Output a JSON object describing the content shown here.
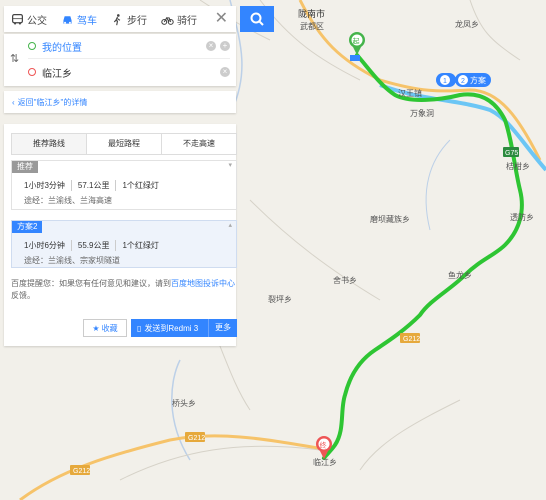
{
  "modes": [
    {
      "label": "公交",
      "icon": "bus-icon"
    },
    {
      "label": "驾车",
      "icon": "car-icon"
    },
    {
      "label": "步行",
      "icon": "walk-icon"
    },
    {
      "label": "骑行",
      "icon": "bike-icon"
    }
  ],
  "active_mode": "驾车",
  "close_label": "✕",
  "route": {
    "start": "我的位置",
    "end": "临江乡"
  },
  "back_link": "返回\"临江乡\"的详情",
  "preferences": [
    "推荐路线",
    "最短路程",
    "不走高速"
  ],
  "plans": [
    {
      "tag": "推荐",
      "time": "1小时3分钟",
      "distance": "57.1公里",
      "lights": "1个红绿灯",
      "via": "途经：兰渝线、兰海高速"
    },
    {
      "tag": "方案2",
      "time": "1小时6分钟",
      "distance": "55.9公里",
      "lights": "1个红绿灯",
      "via": "途经：兰渝线、宗家坝隧道"
    }
  ],
  "tip": {
    "prefix": "百度提醒您：如果您有任何意见和建议，请到",
    "link": "百度地图投诉中心",
    "suffix": "反馈。"
  },
  "buttons": {
    "favorite": "收藏",
    "send": "发送到Redmi 3",
    "more": "更多"
  },
  "map": {
    "labels": {
      "city": "陇南市",
      "district": "武都区",
      "longfeng": "龙凤乡",
      "hanwang": "汉王镇",
      "wanxiang": "万象洞",
      "jubeixiang": "桔柑乡",
      "tianchi": "透防乡",
      "moba": "磨坝藏族乡",
      "yuba": "鱼龙乡",
      "shishu": "舍书乡",
      "qiaotou": "裂坪乡",
      "qiaoyao": "桥头乡",
      "linjiang": "临江乡"
    },
    "roads": {
      "g212": "G212",
      "g75": "G75"
    },
    "markers": {
      "start": "起",
      "end": "终",
      "plan1": "1",
      "plan2": "2",
      "plan2_label": "方案"
    }
  },
  "colors": {
    "route": "#2ec533",
    "accent": "#3385ff",
    "highway": "#6cc6f5",
    "road": "#f6c36a"
  }
}
